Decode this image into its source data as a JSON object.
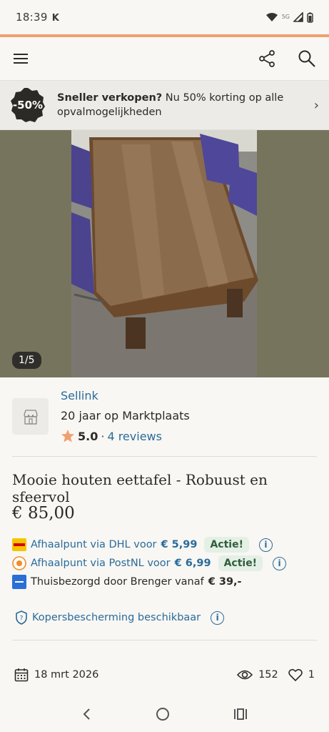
{
  "status_bar": {
    "time": "18:39",
    "extra": "K",
    "network": "5G"
  },
  "header": {
    "menu_icon": "hamburger-icon",
    "share_icon": "share-icon",
    "search_icon": "search-icon"
  },
  "promo": {
    "badge": "-50%",
    "text_bold": "Sneller verkopen?",
    "text_rest": " Nu 50% korting op alle opvalmogelijkheden"
  },
  "photo": {
    "counter": "1/5"
  },
  "seller": {
    "name": "Sellink",
    "years": "20 jaar op Marktplaats",
    "score": "5.0",
    "separator": "·",
    "reviews": "4 reviews"
  },
  "listing": {
    "title": "Mooie houten eettafel - Robuust en sfeervol",
    "price": "€ 85,00"
  },
  "shipping": [
    {
      "label": "Afhaalpunt via DHL voor",
      "price": "€ 5,99",
      "badge": "Actie!",
      "icon": "dhl-icon"
    },
    {
      "label": "Afhaalpunt via PostNL voor",
      "price": "€ 6,99",
      "badge": "Actie!",
      "icon": "postnl-icon"
    },
    {
      "label": "Thuisbezorgd door Brenger vanaf",
      "price": "€ 39,-",
      "icon": "brenger-icon"
    }
  ],
  "protection": {
    "label": "Kopersbescherming beschikbaar"
  },
  "meta": {
    "date": "18 mrt 2026",
    "views": "152",
    "likes": "1"
  },
  "colors": {
    "accent": "#f0a070",
    "link": "#2a6b9c",
    "action_bg": "#e4efe6",
    "dark_badge": "#2f2e2b"
  }
}
